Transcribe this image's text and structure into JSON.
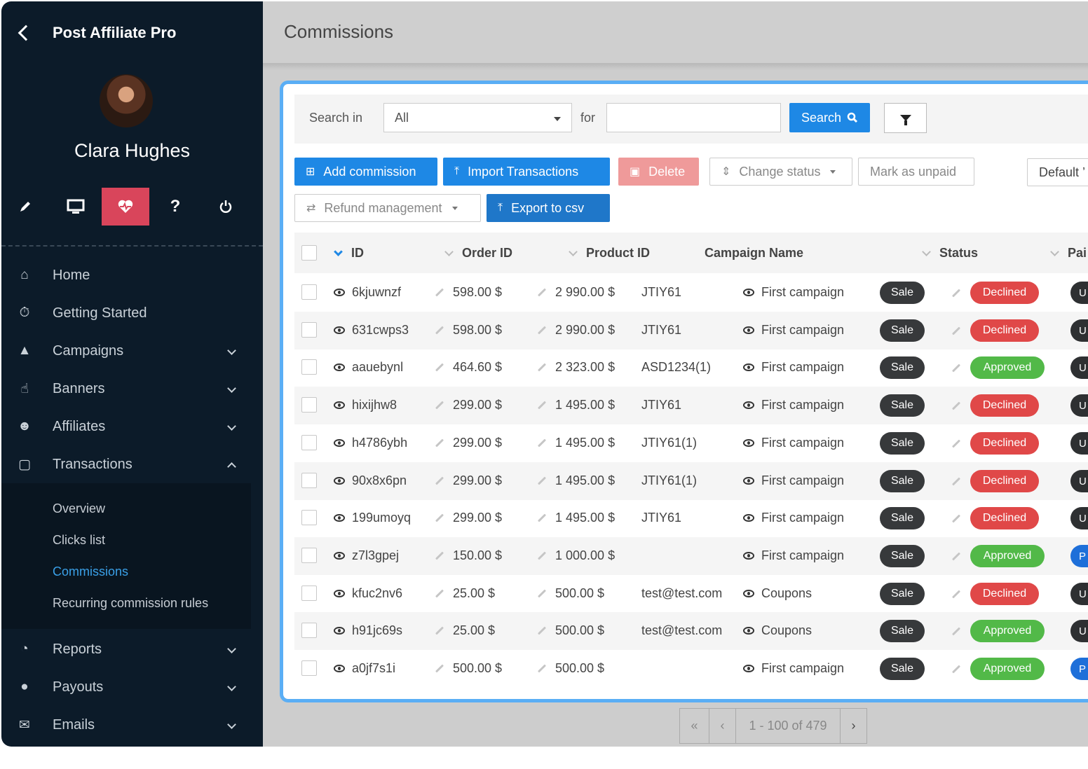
{
  "app": {
    "title": "Post Affiliate Pro"
  },
  "user": {
    "name": "Clara Hughes"
  },
  "icon_bar": [
    "pencil-icon",
    "monitor-icon",
    "heart-pulse-icon",
    "question-icon",
    "power-icon"
  ],
  "nav": {
    "home": "Home",
    "getting_started": "Getting Started",
    "campaigns": "Campaigns",
    "banners": "Banners",
    "affiliates": "Affiliates",
    "transactions": "Transactions",
    "reports": "Reports",
    "payouts": "Payouts",
    "emails": "Emails"
  },
  "submenu": {
    "overview": "Overview",
    "clicks_list": "Clicks list",
    "commissions": "Commissions",
    "recurring": "Recurring commission rules"
  },
  "page": {
    "title": "Commissions"
  },
  "search": {
    "search_in_label": "Search in",
    "search_in_value": "All",
    "for_label": "for",
    "query": "",
    "button": "Search"
  },
  "toolbar": {
    "add_commission": "Add commission",
    "import_transactions": "Import Transactions",
    "delete": "Delete",
    "change_status": "Change status",
    "mark_unpaid": "Mark as unpaid",
    "default_view": "Default ’",
    "refund_management": "Refund management",
    "export_csv": "Export to csv"
  },
  "table": {
    "headers": {
      "id": "ID",
      "order_id": "Order ID",
      "product_id": "Product ID",
      "campaign_name": "Campaign Name",
      "status": "Status",
      "paid": "Pai"
    },
    "rows": [
      {
        "id": "6kjuwnzf",
        "commission": "598.00 $",
        "total": "2 990.00 $",
        "product": "JTIY61",
        "campaign": "First campaign",
        "type": "Sale",
        "status": "Declined",
        "paid": "U"
      },
      {
        "id": "631cwps3",
        "commission": "598.00 $",
        "total": "2 990.00 $",
        "product": "JTIY61",
        "campaign": "First campaign",
        "type": "Sale",
        "status": "Declined",
        "paid": "U"
      },
      {
        "id": "aauebynl",
        "commission": "464.60 $",
        "total": "2 323.00 $",
        "product": "ASD1234(1)",
        "campaign": "First campaign",
        "type": "Sale",
        "status": "Approved",
        "paid": "U"
      },
      {
        "id": "hixijhw8",
        "commission": "299.00 $",
        "total": "1 495.00 $",
        "product": "JTIY61",
        "campaign": "First campaign",
        "type": "Sale",
        "status": "Declined",
        "paid": "U"
      },
      {
        "id": "h4786ybh",
        "commission": "299.00 $",
        "total": "1 495.00 $",
        "product": "JTIY61(1)",
        "campaign": "First campaign",
        "type": "Sale",
        "status": "Declined",
        "paid": "U"
      },
      {
        "id": "90x8x6pn",
        "commission": "299.00 $",
        "total": "1 495.00 $",
        "product": "JTIY61(1)",
        "campaign": "First campaign",
        "type": "Sale",
        "status": "Declined",
        "paid": "U"
      },
      {
        "id": "199umoyq",
        "commission": "299.00 $",
        "total": "1 495.00 $",
        "product": "JTIY61",
        "campaign": "First campaign",
        "type": "Sale",
        "status": "Declined",
        "paid": "U"
      },
      {
        "id": "z7l3gpej",
        "commission": "150.00 $",
        "total": "1 000.00 $",
        "product": "",
        "campaign": "First campaign",
        "type": "Sale",
        "status": "Approved",
        "paid": "P"
      },
      {
        "id": "kfuc2nv6",
        "commission": "25.00 $",
        "total": "500.00 $",
        "product": "test@test.com",
        "campaign": "Coupons",
        "type": "Sale",
        "status": "Declined",
        "paid": "U"
      },
      {
        "id": "h91jc69s",
        "commission": "25.00 $",
        "total": "500.00 $",
        "product": "test@test.com",
        "campaign": "Coupons",
        "type": "Sale",
        "status": "Approved",
        "paid": "U"
      },
      {
        "id": "a0jf7s1i",
        "commission": "500.00 $",
        "total": "500.00 $",
        "product": "",
        "campaign": "First campaign",
        "type": "Sale",
        "status": "Approved",
        "paid": "P"
      }
    ]
  },
  "pager": {
    "first": "«",
    "prev": "‹",
    "range": "1 - 100 of 479",
    "next": "›"
  },
  "colors": {
    "sidebar": "#0c1b29",
    "accent": "#1e88e5",
    "active_icon": "#d9455b",
    "declined": "#e04848",
    "approved": "#52b948",
    "panel_border": "#5aaef5"
  }
}
